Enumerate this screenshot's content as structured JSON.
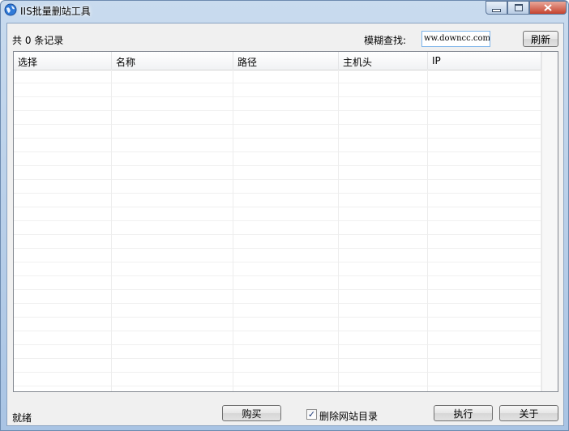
{
  "window": {
    "title": "IIS批量删站工具"
  },
  "toolbar": {
    "record_count": "共 0 条记录",
    "search_label": "模糊查找:",
    "search_value": "ww.downcc.com",
    "refresh_label": "刷新"
  },
  "list": {
    "columns": [
      "选择",
      "名称",
      "路径",
      "主机头",
      "IP"
    ],
    "rows": []
  },
  "footer": {
    "status": "就绪",
    "buy_label": "购买",
    "delete_dir_label": "删除网站目录",
    "delete_dir_checked": true,
    "execute_label": "执行",
    "about_label": "关于"
  },
  "icons": {
    "app": "globe-icon",
    "minimize": "minimize-icon",
    "maximize": "maximize-icon",
    "close": "close-icon",
    "check": "checkmark-icon"
  }
}
